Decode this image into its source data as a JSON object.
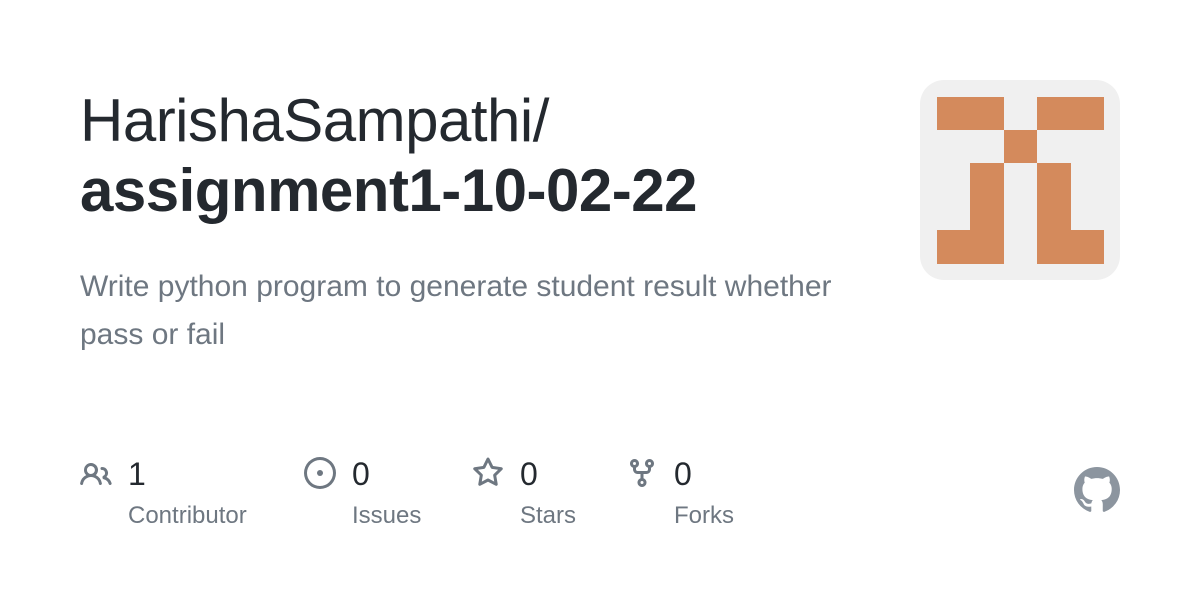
{
  "repo": {
    "owner": "HarishaSampathi/",
    "name": "assignment1-10-02-22",
    "description": "Write python program to generate student result whether pass or fail"
  },
  "avatar": {
    "identicon_color": "#d48a5c",
    "background_color": "#f0f0f0"
  },
  "stats": [
    {
      "icon": "people-icon",
      "value": "1",
      "label": "Contributor"
    },
    {
      "icon": "issue-opened-icon",
      "value": "0",
      "label": "Issues"
    },
    {
      "icon": "star-icon",
      "value": "0",
      "label": "Stars"
    },
    {
      "icon": "repo-forked-icon",
      "value": "0",
      "label": "Forks"
    }
  ],
  "colors": {
    "text_primary": "#24292f",
    "text_secondary": "#6e7781",
    "logo": "#8c959f"
  },
  "brand_icon": "github-mark-icon"
}
